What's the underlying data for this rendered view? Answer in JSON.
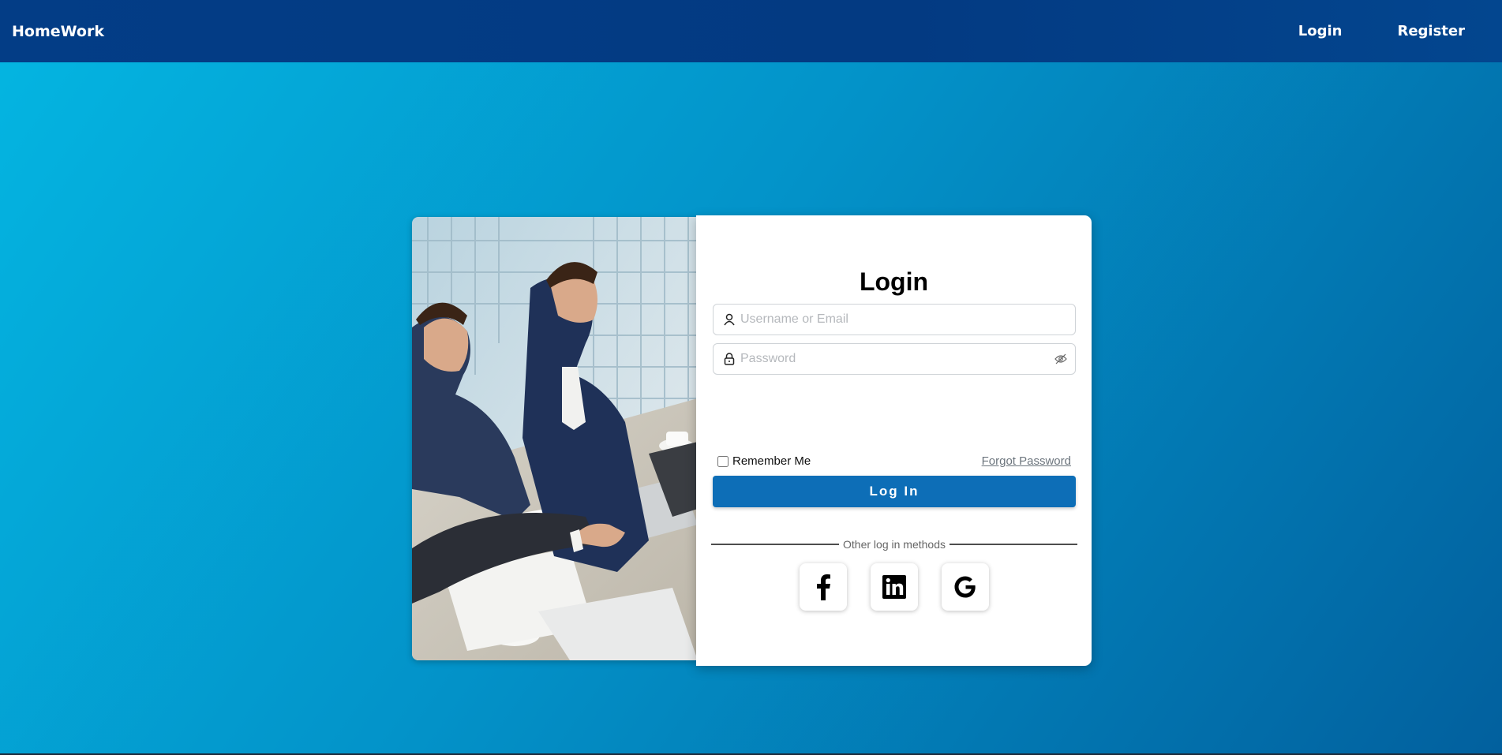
{
  "navbar": {
    "brand": "HomeWork",
    "links": [
      {
        "label": "Login"
      },
      {
        "label": "Register"
      }
    ]
  },
  "login": {
    "title": "Login",
    "username_placeholder": "Username or Email",
    "password_placeholder": "Password",
    "remember_label": "Remember Me",
    "forgot_label": "Forgot Password",
    "submit_label": "Log In",
    "other_methods_label": "Other log in methods",
    "social": [
      {
        "name": "facebook",
        "icon": "facebook-icon"
      },
      {
        "name": "linkedin",
        "icon": "linkedin-icon"
      },
      {
        "name": "google",
        "icon": "google-icon"
      }
    ]
  },
  "colors": {
    "navbar": "#033d86",
    "background_start": "#04b6e2",
    "background_end": "#02609e",
    "primary_button": "#0d6eb7"
  }
}
